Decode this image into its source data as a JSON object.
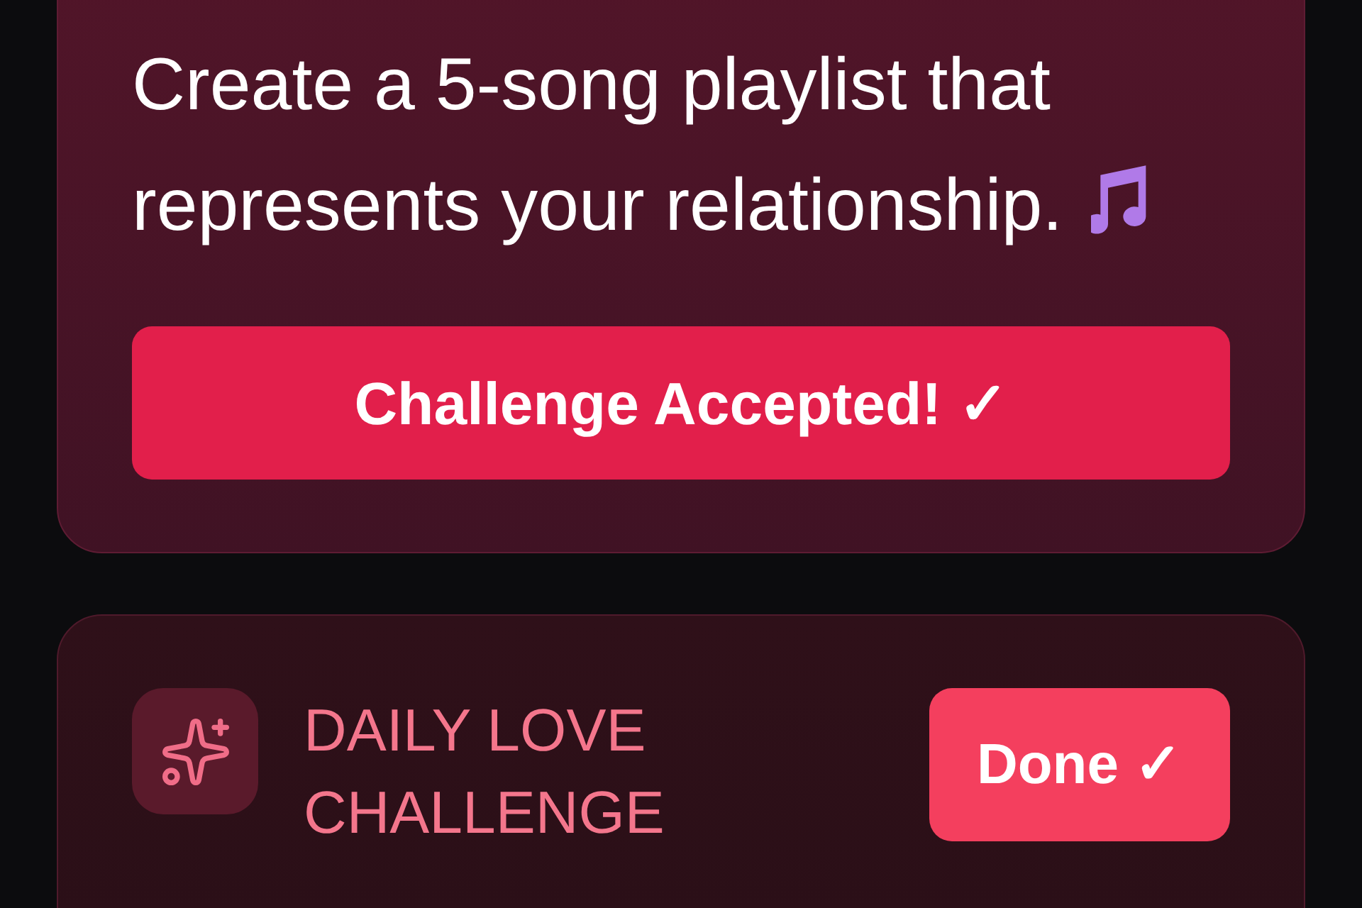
{
  "playlist_challenge": {
    "prompt": "Create a 5-song playlist that represents your relationship.",
    "button": "Challenge Accepted! ✓"
  },
  "daily_challenge": {
    "title": "DAILY LOVE CHALLENGE",
    "button": "Done ✓"
  }
}
